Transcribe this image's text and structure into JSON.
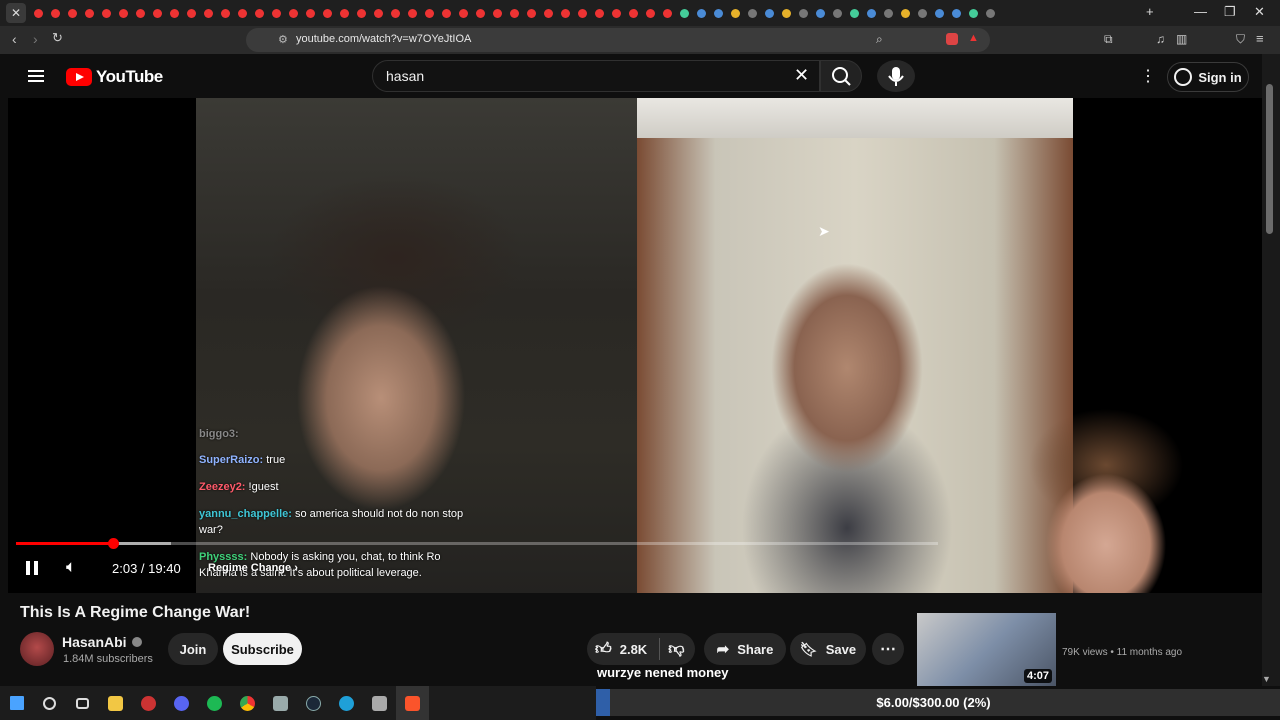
{
  "browser": {
    "url": "youtube.com/watch?v=w7OYeJtIOA"
  },
  "youtube": {
    "logo_text": "YouTube",
    "search_query": "hasan",
    "sign_in": "Sign in"
  },
  "player": {
    "time": "2:03 / 19:40",
    "chapter": "Regime Change",
    "progress": 0.105,
    "buffered": 0.168
  },
  "chat": [
    {
      "user": "biggo3:",
      "text": "",
      "color": "#888888"
    },
    {
      "user": "SuperRaizo:",
      "text": "true",
      "color": "#8fb3ff"
    },
    {
      "user": "Zeezey2:",
      "text": "!guest",
      "color": "#ff5a6a"
    },
    {
      "user": "yannu_chappelle:",
      "text": "so america should not do non stop",
      "color": "#3fc6d6"
    },
    {
      "user": "",
      "text": "war?",
      "color": "#ffffff"
    },
    {
      "user": "Physsss:",
      "text": "Nobody is asking you, chat, to think Ro",
      "color": "#3fd17a"
    },
    {
      "user": "",
      "text": "Khanna is a saint. It's about political leverage.",
      "color": "#ffffff"
    }
  ],
  "video": {
    "title": "This Is A Regime Change War!",
    "channel": "HasanAbi",
    "subscribers": "1.84M subscribers",
    "join": "Join",
    "subscribe": "Subscribe",
    "likes": "2.8K",
    "share": "Share",
    "save": "Save"
  },
  "sidebar": {
    "duration": "4:07",
    "meta": "79K views • 11 months ago"
  },
  "overlay": {
    "donation_name": "wurzye nened money",
    "goal_text": "$6.00/$300.00 (2%)",
    "goal_fraction": 0.02
  },
  "colors": {
    "accent": "#ff0000",
    "goal_fill": "#2f5fa8"
  }
}
